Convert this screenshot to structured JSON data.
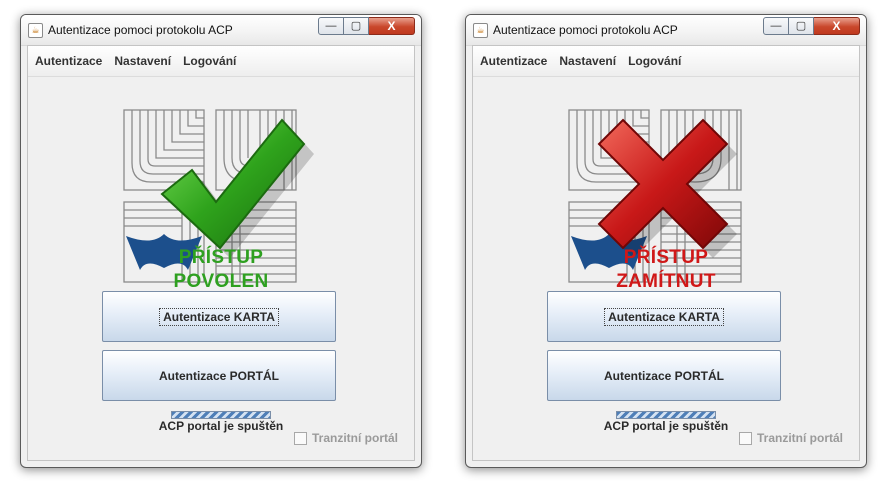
{
  "windows": [
    {
      "title": "Autentizace pomoci protokolu ACP",
      "menu": [
        "Autentizace",
        "Nastavení",
        "Logování"
      ],
      "status_line1": "PŘÍSTUP",
      "status_line2": "POVOLEN",
      "status_color": "#2ea020",
      "overlay_icon": "checkmark-icon",
      "karta_button": "Autentizace KARTA",
      "portal_button": "Autentizace PORTÁL",
      "portal_status": "ACP portal je spuštěn",
      "transit_label": "Tranzitní portál",
      "transit_checked": false
    },
    {
      "title": "Autentizace pomoci protokolu ACP",
      "menu": [
        "Autentizace",
        "Nastavení",
        "Logování"
      ],
      "status_line1": "PŘÍSTUP",
      "status_line2": "ZAMÍTNUT",
      "status_color": "#d01818",
      "overlay_icon": "cross-icon",
      "karta_button": "Autentizace KARTA",
      "portal_button": "Autentizace PORTÁL",
      "portal_status": "ACP portal je spuštěn",
      "transit_label": "Tranzitní portál",
      "transit_checked": false
    }
  ],
  "caption_buttons": {
    "minimize": "—",
    "maximize": "▢",
    "close": "X"
  },
  "colors": {
    "accent_blue": "#1c4f8c",
    "granted_green": "#2ea020",
    "denied_red": "#d01818"
  }
}
